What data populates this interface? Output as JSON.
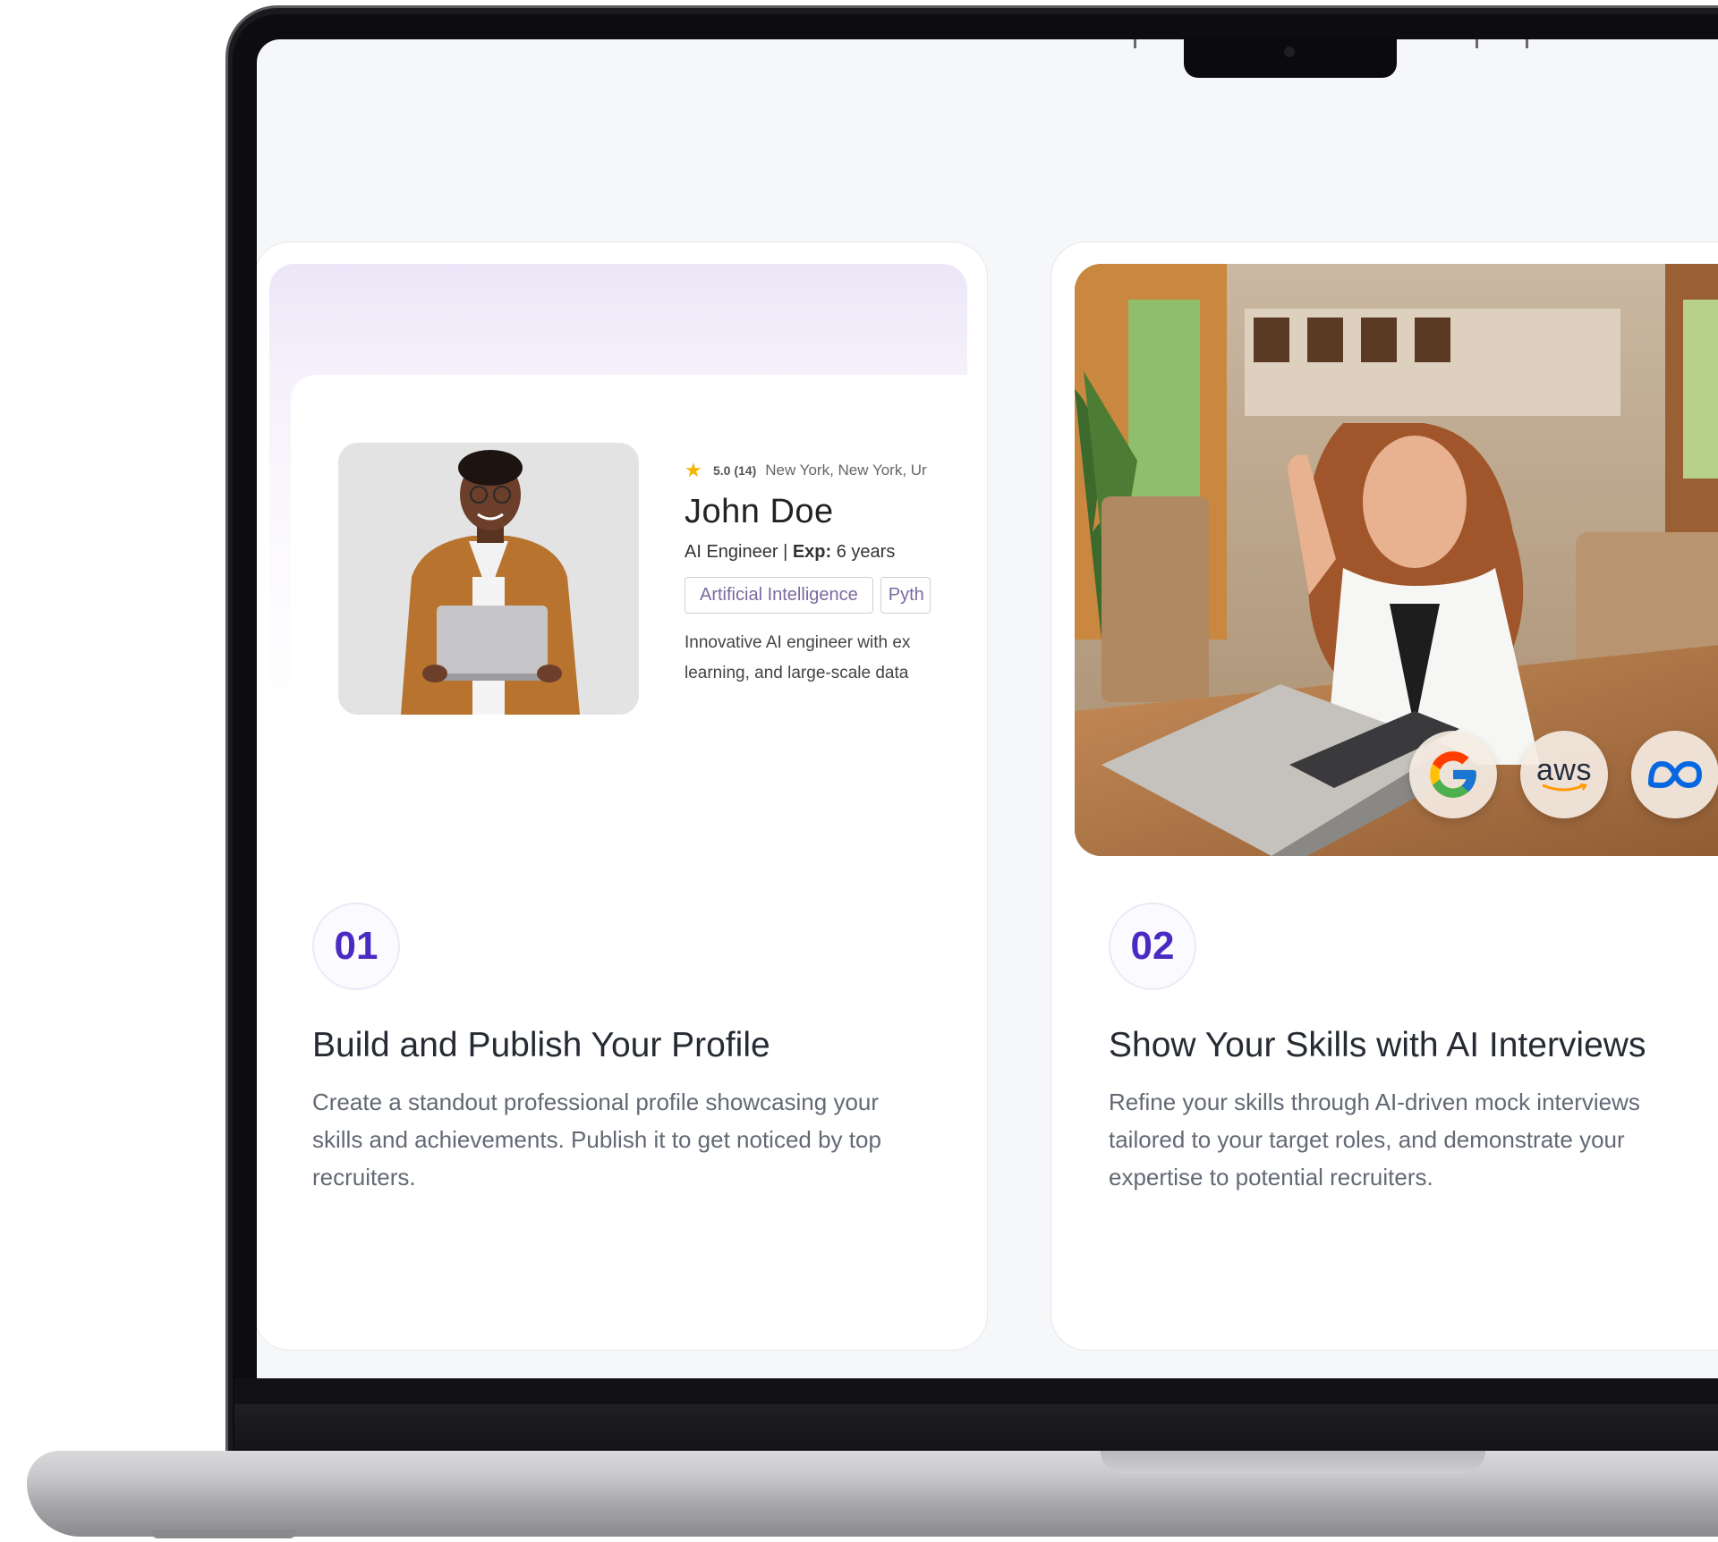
{
  "profile_preview": {
    "rating": "5.0 (14)",
    "location": "New York, New York, Ur",
    "name": "John Doe",
    "role": "AI Engineer |",
    "exp_label": "Exp:",
    "exp_value": "6 years",
    "tags": [
      "Artificial Intelligence",
      "Pyth"
    ],
    "bio_line_1": "Innovative AI engineer with ex",
    "bio_line_2": "learning, and large-scale data"
  },
  "steps": [
    {
      "number": "01",
      "title": "Build and Publish Your Profile",
      "description": "Create a standout professional profile showcasing your skills and achievements. Publish it to get noticed by top recruiters."
    },
    {
      "number": "02",
      "title": "Show Your Skills with AI Interviews",
      "description": "Refine your skills through AI-driven mock interviews tailored to your target roles, and demonstrate your expertise to potential recruiters."
    }
  ],
  "company_logos": {
    "google": "google-logo",
    "aws": "aws",
    "meta": "meta-logo"
  },
  "colors": {
    "accent": "#4a2bc2",
    "title": "#262b33",
    "body_text": "#636974",
    "screen_bg": "#f6f7f9"
  }
}
